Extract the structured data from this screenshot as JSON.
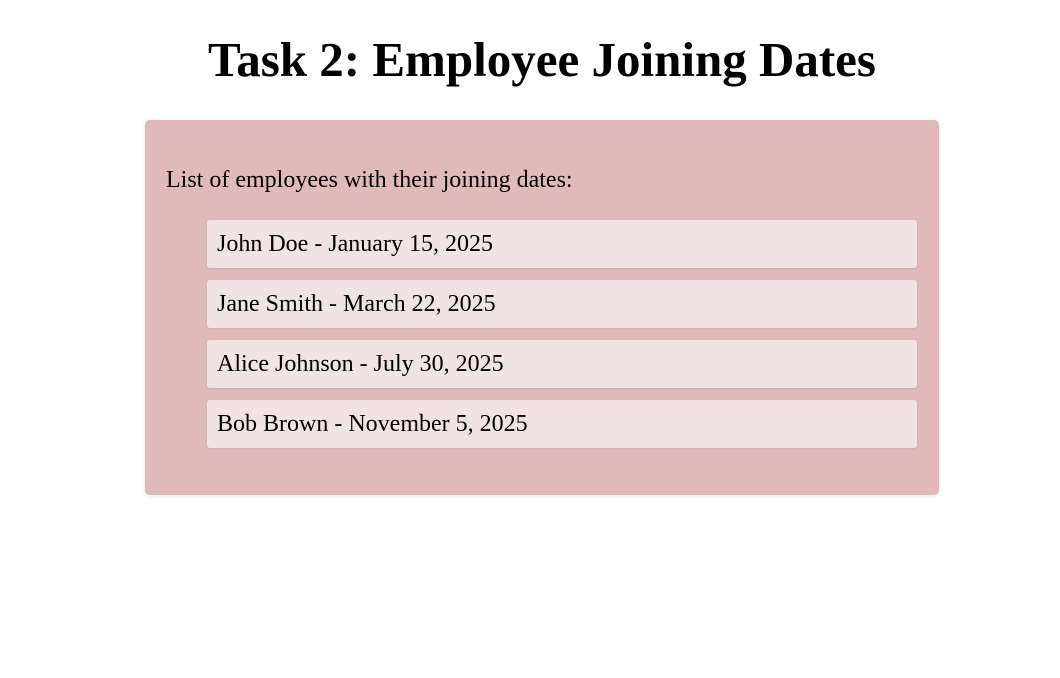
{
  "page": {
    "title": "Task 2: Employee Joining Dates"
  },
  "card": {
    "intro": "List of employees with their joining dates:",
    "background_color": "#e0b9ba",
    "item_background_color": "#f1e3e3",
    "employees": [
      {
        "text": "John Doe - January 15, 2025"
      },
      {
        "text": "Jane Smith - March 22, 2025"
      },
      {
        "text": "Alice Johnson - July 30, 2025"
      },
      {
        "text": "Bob Brown - November 5, 2025"
      }
    ]
  }
}
